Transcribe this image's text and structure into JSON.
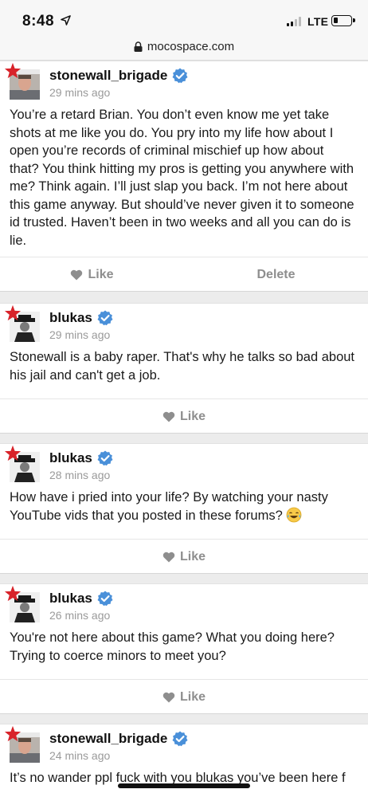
{
  "status_bar": {
    "time": "8:48",
    "network": "LTE",
    "signal_bars": 2,
    "battery_level": 0.25
  },
  "browser": {
    "url": "mocospace.com"
  },
  "icons": {
    "verified": "verified-check-icon",
    "like": "heart-icon",
    "badge": "red-star-icon",
    "emoji": "tears-of-joy-emoji"
  },
  "colors": {
    "verified_blue": "#4a90d9",
    "star_red": "#d8232a",
    "action_gray": "#8e8e8e",
    "timestamp_gray": "#9a9a9a"
  },
  "posts": [
    {
      "username": "stonewall_brigade",
      "time": "29 mins ago",
      "text": "You’re a retard Brian. You don’t even know me yet take shots at me like you do. You pry into my life how about I open you’re records of criminal mischief up how about that? You think hitting my pros is getting you anywhere with me? Think again. I’ll just slap you back. I’m not here about this game anyway. But should’ve never given it to someone id trusted. Haven’t been in two weeks and all you can do is lie.",
      "like_label": "Like",
      "delete_label": "Delete"
    },
    {
      "username": "blukas",
      "time": "29 mins ago",
      "text": "Stonewall is a baby raper. That's why he talks so bad about his jail and can't get a job.",
      "like_label": "Like"
    },
    {
      "username": "blukas",
      "time": "28 mins ago",
      "text": "How have i pried into your life? By watching your nasty YouTube vids that you posted in these forums?",
      "like_label": "Like"
    },
    {
      "username": "blukas",
      "time": "26 mins ago",
      "text": "You're not here about this game? What you doing here? Trying to coerce minors to meet you?",
      "like_label": "Like"
    },
    {
      "username": "stonewall_brigade",
      "time": "24 mins ago",
      "text": "It’s no wander ppl fuck with you blukas you’ve been here f"
    }
  ]
}
